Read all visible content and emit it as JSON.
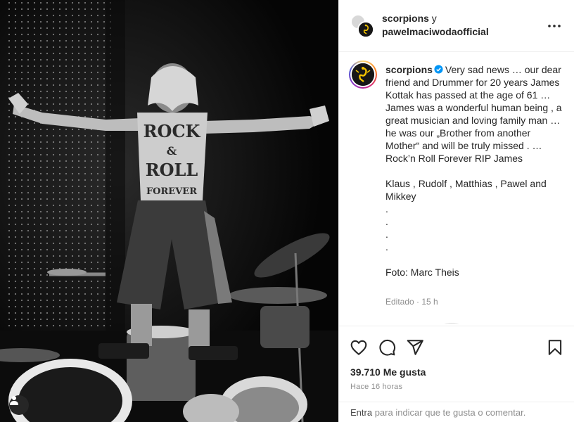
{
  "post": {
    "header": {
      "author_primary": "scorpions",
      "conjunction": "y",
      "author_secondary": "pawelmaciwodaofficial"
    },
    "caption": {
      "username": "scorpions",
      "text": "Very sad news … our dear friend and Drummer for 20 years James Kottak has passed at the age of 61 … James was a wonderful human being , a great musician and loving family man … he was our „Brother from another Mother“ and will be truly missed . … Rock’n Roll Forever RIP James\n\nKlaus , Rudolf , Matthias , Pawel and Mikkey\n.\n.\n.\n.\n\nFoto: Marc Theis",
      "meta": "Editado · 15 h"
    },
    "likes": "39.710 Me gusta",
    "time_ago": "Hace 16 horas",
    "comment_prompt": {
      "link": "Entra",
      "rest": " para indicar que te gusta o comentar."
    },
    "photo": {
      "back_text_line1": "ROCK",
      "back_text_line2": "&",
      "back_text_line3": "ROLL",
      "back_text_line4": "FOREVER"
    }
  },
  "icons": [
    "more-options-icon",
    "verified-icon",
    "heart-icon",
    "comment-icon",
    "share-icon",
    "bookmark-icon",
    "user-tag-icon"
  ],
  "colors": {
    "verified": "#0095f6",
    "muted_text": "#8e8e8e",
    "divider": "#efefef"
  }
}
